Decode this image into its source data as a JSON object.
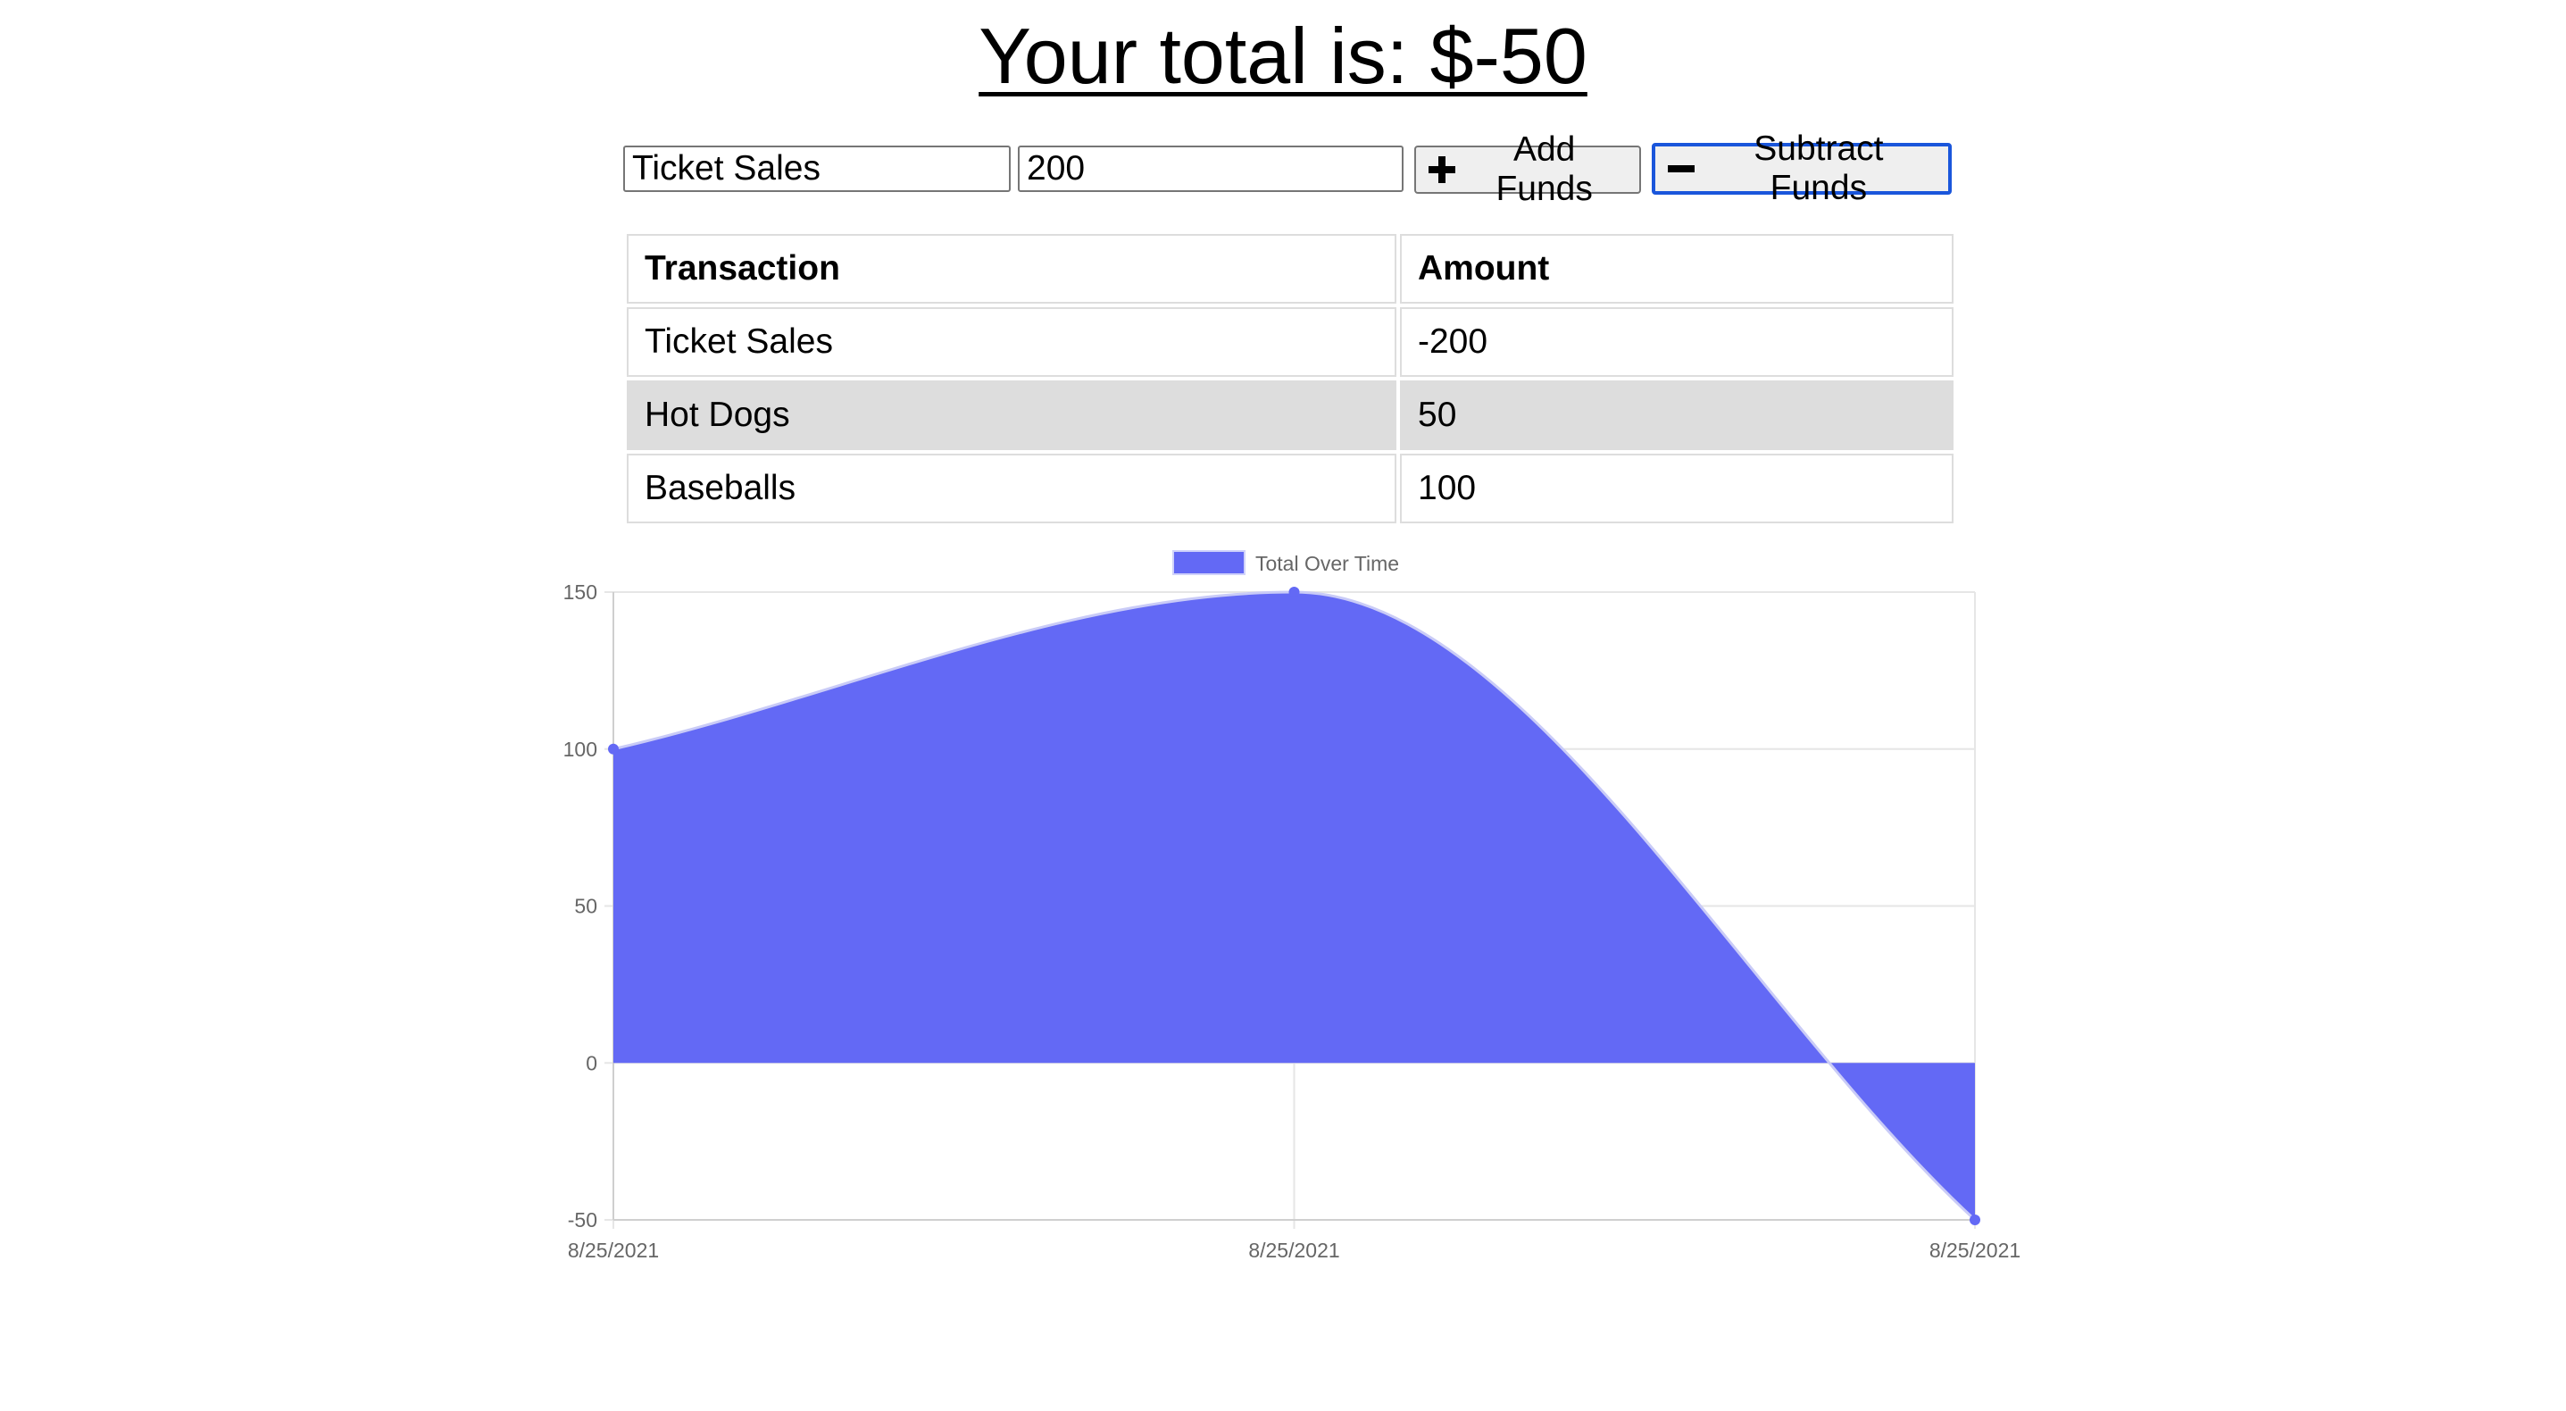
{
  "header": {
    "title": "Your total is: $-50"
  },
  "form": {
    "name_value": "Ticket Sales",
    "amount_value": "200",
    "add_label": "Add Funds",
    "subtract_label": "Subtract Funds"
  },
  "table": {
    "headers": [
      "Transaction",
      "Amount"
    ],
    "rows": [
      {
        "name": "Ticket Sales",
        "amount": "-200"
      },
      {
        "name": "Hot Dogs",
        "amount": "50"
      },
      {
        "name": "Baseballs",
        "amount": "100"
      }
    ]
  },
  "colors": {
    "series_fill": "#6369f5",
    "grid": "#e6e6e6",
    "highlight_row": "#dddddd",
    "focus_border": "#1a56db"
  },
  "chart_data": {
    "type": "area",
    "x": [
      "8/25/2021",
      "8/25/2021",
      "8/25/2021"
    ],
    "series": [
      {
        "name": "Total Over Time",
        "values": [
          100,
          150,
          -50
        ]
      }
    ],
    "ylim": [
      -50,
      150
    ],
    "yticks": [
      150,
      100,
      50,
      0,
      -50
    ],
    "grid": true,
    "legend": "top-center",
    "xlabel": "",
    "ylabel": ""
  }
}
